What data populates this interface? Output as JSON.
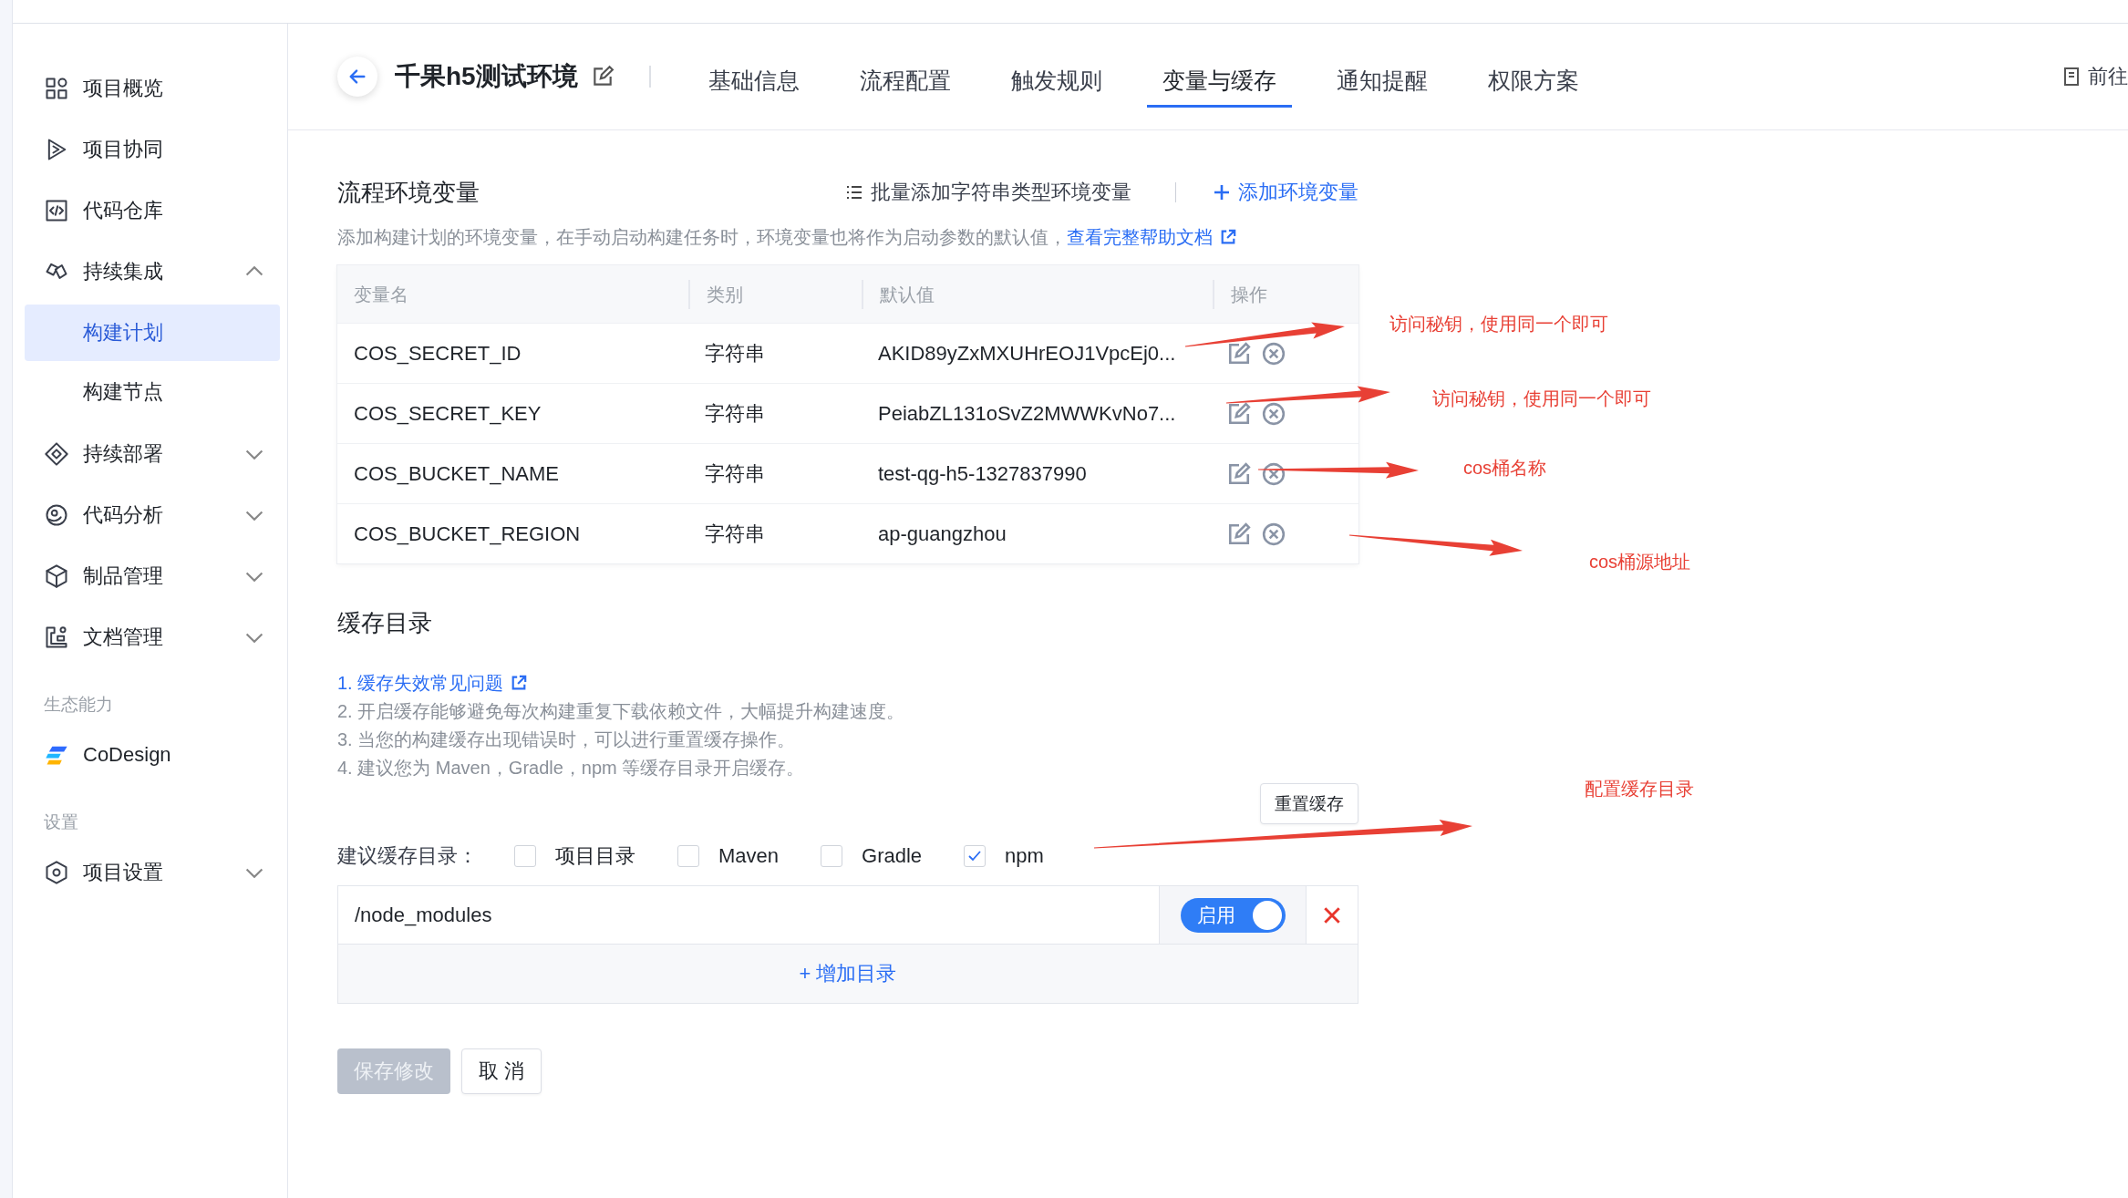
{
  "sidebar": {
    "items": [
      {
        "label": "项目概览",
        "selected": false
      },
      {
        "label": "项目协同",
        "selected": false
      },
      {
        "label": "代码仓库",
        "selected": false
      },
      {
        "label": "持续集成",
        "selected": false,
        "expanded": true,
        "children": [
          {
            "label": "构建计划",
            "selected": true
          },
          {
            "label": "构建节点",
            "selected": false
          }
        ]
      },
      {
        "label": "持续部署",
        "selected": false,
        "expanded": false
      },
      {
        "label": "代码分析",
        "selected": false,
        "expanded": false
      },
      {
        "label": "制品管理",
        "selected": false,
        "expanded": false
      },
      {
        "label": "文档管理",
        "selected": false,
        "expanded": false
      }
    ],
    "sections": [
      {
        "title": "生态能力",
        "items": [
          {
            "label": "CoDesign",
            "selected": false
          }
        ]
      },
      {
        "title": "设置",
        "items": [
          {
            "label": "项目设置",
            "selected": false,
            "expanded": false
          }
        ]
      }
    ]
  },
  "header": {
    "title": "千果h5测试环境",
    "tabs": [
      {
        "label": "基础信息",
        "selected": false
      },
      {
        "label": "流程配置",
        "selected": false
      },
      {
        "label": "触发规则",
        "selected": false
      },
      {
        "label": "变量与缓存",
        "selected": true
      },
      {
        "label": "通知提醒",
        "selected": false
      },
      {
        "label": "权限方案",
        "selected": false
      }
    ],
    "right_link": "前往"
  },
  "env_vars": {
    "title": "流程环境变量",
    "batch_add": "批量添加字符串类型环境变量",
    "add": "添加环境变量",
    "description": "添加构建计划的环境变量，在手动启动构建任务时，环境变量也将作为启动参数的默认值，",
    "help_link": "查看完整帮助文档",
    "table": {
      "columns": [
        "变量名",
        "类别",
        "默认值",
        "操作"
      ],
      "rows": [
        {
          "name": "COS_SECRET_ID",
          "type": "字符串",
          "value": "AKID89yZxMXUHrEOJ1VpcEj0..."
        },
        {
          "name": "COS_SECRET_KEY",
          "type": "字符串",
          "value": "PeiabZL131oSvZ2MWWKvNo7..."
        },
        {
          "name": "COS_BUCKET_NAME",
          "type": "字符串",
          "value": "test-qg-h5-1327837990"
        },
        {
          "name": "COS_BUCKET_REGION",
          "type": "字符串",
          "value": "ap-guangzhou"
        }
      ]
    }
  },
  "cache": {
    "title": "缓存目录",
    "notes": [
      {
        "kind": "link",
        "text": "1. 缓存失效常见问题"
      },
      {
        "kind": "text",
        "text": "2. 开启缓存能够避免每次构建重复下载依赖文件，大幅提升构建速度。"
      },
      {
        "kind": "text",
        "text": "3. 当您的构建缓存出现错误时，可以进行重置缓存操作。"
      },
      {
        "kind": "text",
        "text": "4. 建议您为 Maven，Gradle，npm 等缓存目录开启缓存。"
      }
    ],
    "reset": "重置缓存",
    "suggest_label": "建议缓存目录：",
    "options": [
      {
        "label": "项目目录",
        "checked": false
      },
      {
        "label": "Maven",
        "checked": false
      },
      {
        "label": "Gradle",
        "checked": false
      },
      {
        "label": "npm",
        "checked": true
      }
    ],
    "dirs": [
      {
        "path": "/node_modules",
        "enabled": true,
        "toggle_label": "启用"
      }
    ],
    "add_dir": "+ 增加目录"
  },
  "actions": {
    "save": {
      "label": "保存修改",
      "disabled": true
    },
    "cancel": "取 消"
  },
  "annotations": [
    {
      "text": "访问秘钥，使用同一个即可"
    },
    {
      "text": "访问秘钥，使用同一个即可"
    },
    {
      "text": "cos桶名称"
    },
    {
      "text": "cos桶源地址"
    },
    {
      "text": "配置缓存目录"
    }
  ]
}
